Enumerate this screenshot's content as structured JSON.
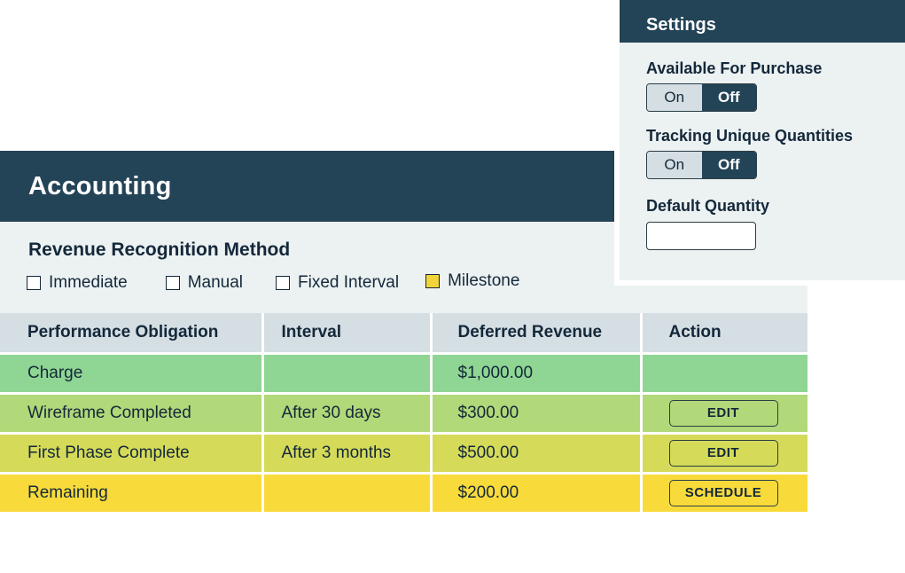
{
  "accounting": {
    "title": "Accounting",
    "recognition": {
      "title": "Revenue Recognition Method",
      "options": [
        {
          "label": "Immediate",
          "checked": false
        },
        {
          "label": "Manual",
          "checked": false
        },
        {
          "label": "Fixed Interval",
          "checked": false
        },
        {
          "label": "Milestone",
          "checked": true
        }
      ]
    },
    "table": {
      "columns": [
        "Performance Obligation",
        "Interval",
        "Deferred Revenue",
        "Action"
      ],
      "rows": [
        {
          "obligation": "Charge",
          "interval": "",
          "deferred": "$1,000.00",
          "action": "",
          "color": "#8fd593"
        },
        {
          "obligation": "Wireframe Completed",
          "interval": "After 30 days",
          "deferred": "$300.00",
          "action": "EDIT",
          "color": "#b1d879"
        },
        {
          "obligation": "First Phase Complete",
          "interval": "After 3 months",
          "deferred": "$500.00",
          "action": "EDIT",
          "color": "#d5da59"
        },
        {
          "obligation": "Remaining",
          "interval": "",
          "deferred": "$200.00",
          "action": "SCHEDULE",
          "color": "#f8db3a"
        }
      ]
    }
  },
  "settings": {
    "title": "Settings",
    "available_for_purchase": {
      "label": "Available For Purchase",
      "on_label": "On",
      "off_label": "Off",
      "value": "Off"
    },
    "tracking_unique_quantities": {
      "label": "Tracking Unique Quantities",
      "on_label": "On",
      "off_label": "Off",
      "value": "Off"
    },
    "default_quantity": {
      "label": "Default Quantity",
      "value": ""
    }
  },
  "colors": {
    "header": "#234357",
    "panel_bg": "#ecf1f2",
    "table_header_bg": "#d4dee3",
    "milestone_check": "#f2d43a"
  }
}
